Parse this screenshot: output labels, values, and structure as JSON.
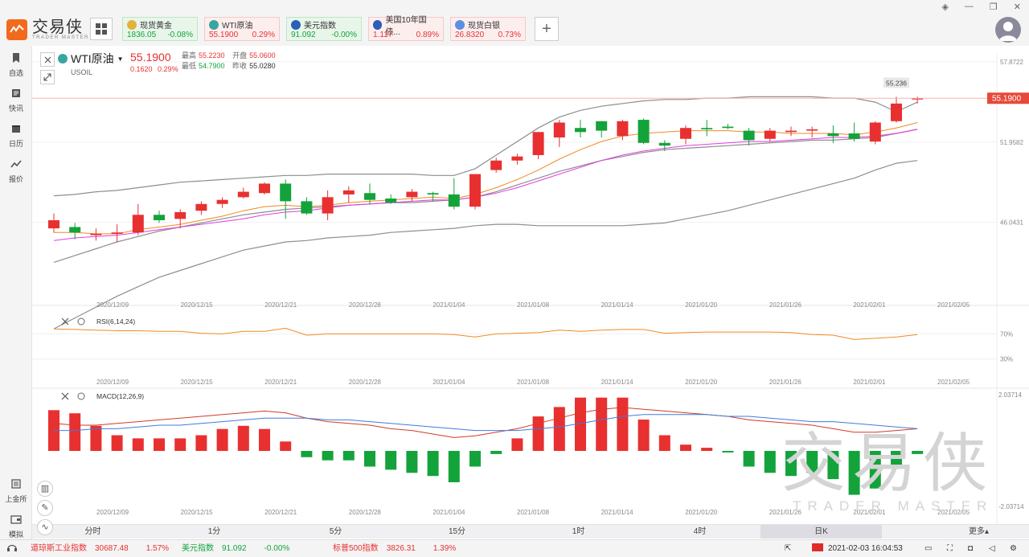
{
  "app": {
    "logo_cn": "交易侠",
    "logo_en": "TRADER MASTER",
    "colors": {
      "up": "#e83030",
      "down": "#13a33a",
      "accent": "#f26a1b",
      "ma_short": "#f08a24",
      "ma_long": "#e23ce2"
    }
  },
  "tickers": [
    {
      "name": "现货黄金",
      "price": "1836.05",
      "change": "-0.08%",
      "dir": "down",
      "icon_color": "#e3b23c"
    },
    {
      "name": "WTI原油",
      "price": "55.1900",
      "change": "0.29%",
      "dir": "up",
      "icon_color": "#3aa5a0"
    },
    {
      "name": "美元指数",
      "price": "91.092",
      "change": "-0.00%",
      "dir": "down",
      "icon_color": "#2b5fb8"
    },
    {
      "name": "美国10年国债...",
      "price": "1.117",
      "change": "0.89%",
      "dir": "up",
      "icon_color": "#2b5fb8"
    },
    {
      "name": "现货白银",
      "price": "26.8320",
      "change": "0.73%",
      "dir": "up",
      "icon_color": "#5b8fe0"
    }
  ],
  "sidebar": [
    {
      "label": "自选",
      "icon": "bookmark-icon"
    },
    {
      "label": "快讯",
      "icon": "news-icon"
    },
    {
      "label": "日历",
      "icon": "calendar-icon"
    },
    {
      "label": "报价",
      "icon": "quote-icon"
    }
  ],
  "sidebar_bottom": [
    {
      "label": "上金所",
      "icon": "exchange-icon"
    },
    {
      "label": "模拟",
      "icon": "wallet-icon"
    }
  ],
  "symbol": {
    "name": "WTI原油",
    "code": "USOIL",
    "price": "55.1900",
    "change": "0.1620",
    "change_pct": "0.29%",
    "high_label": "最高",
    "high": "55.2230",
    "open_label": "开盘",
    "open": "55.0600",
    "low_label": "最低",
    "low": "54.7900",
    "prev_label": "昨收",
    "prev": "55.0280"
  },
  "chart_data": {
    "type": "candlestick",
    "dates_axis": [
      "2020/12/09",
      "2020/12/15",
      "2020/12/21",
      "2020/12/28",
      "2021/01/04",
      "2021/01/08",
      "2021/01/14",
      "2021/01/20",
      "2021/01/26",
      "2021/02/01",
      "2021/02/05"
    ],
    "price_axis": [
      "57.8722",
      "51.9582",
      "46.0431"
    ],
    "ylim": [
      40.1,
      57.87
    ],
    "current_price_label": "55.1900",
    "current_price": 55.19,
    "high_marker_label": "55.236",
    "high_marker": 55.236,
    "candles": [
      [
        45.6,
        46.2,
        45.3,
        46.7
      ],
      [
        45.7,
        45.3,
        44.8,
        46.0
      ],
      [
        45.1,
        45.2,
        44.7,
        45.6
      ],
      [
        45.2,
        45.3,
        44.6,
        45.9
      ],
      [
        45.3,
        46.6,
        45.1,
        47.4
      ],
      [
        46.6,
        46.2,
        46.0,
        46.9
      ],
      [
        46.3,
        46.8,
        45.6,
        47.0
      ],
      [
        46.9,
        47.4,
        46.6,
        47.6
      ],
      [
        47.4,
        47.7,
        47.1,
        47.9
      ],
      [
        47.9,
        48.3,
        47.8,
        48.6
      ],
      [
        48.2,
        48.9,
        48.1,
        49.0
      ],
      [
        48.9,
        47.6,
        46.3,
        49.2
      ],
      [
        47.6,
        46.7,
        46.6,
        47.9
      ],
      [
        46.7,
        47.9,
        46.2,
        48.4
      ],
      [
        48.1,
        48.4,
        47.5,
        48.7
      ],
      [
        48.2,
        47.7,
        47.4,
        48.9
      ],
      [
        47.8,
        47.5,
        47.4,
        48.1
      ],
      [
        47.9,
        48.3,
        47.6,
        48.5
      ],
      [
        48.2,
        48.1,
        47.6,
        48.3
      ],
      [
        48.1,
        47.2,
        47.0,
        49.3
      ],
      [
        47.2,
        49.6,
        47.0,
        49.6
      ],
      [
        49.9,
        50.6,
        49.7,
        50.8
      ],
      [
        50.6,
        50.9,
        50.3,
        51.1
      ],
      [
        51.0,
        52.7,
        50.7,
        52.7
      ],
      [
        52.3,
        53.4,
        51.6,
        53.6
      ],
      [
        53.0,
        52.7,
        52.3,
        53.6
      ],
      [
        53.5,
        52.8,
        52.3,
        53.5
      ],
      [
        52.4,
        53.5,
        52.1,
        53.6
      ],
      [
        53.6,
        51.9,
        51.8,
        53.7
      ],
      [
        51.9,
        51.7,
        51.3,
        52.1
      ],
      [
        52.2,
        53.0,
        51.8,
        53.2
      ],
      [
        53.0,
        52.9,
        52.4,
        53.6
      ],
      [
        53.1,
        53.0,
        52.9,
        53.3
      ],
      [
        52.8,
        52.1,
        51.7,
        53.0
      ],
      [
        52.2,
        52.8,
        52.0,
        53.0
      ],
      [
        52.7,
        52.8,
        52.4,
        53.1
      ],
      [
        52.8,
        52.9,
        52.3,
        53.1
      ],
      [
        52.6,
        52.4,
        51.9,
        53.2
      ],
      [
        52.6,
        52.2,
        52.0,
        53.4
      ],
      [
        52.0,
        53.4,
        51.8,
        53.5
      ],
      [
        53.5,
        54.8,
        53.4,
        55.3
      ],
      [
        55.1,
        55.2,
        54.8,
        55.3
      ]
    ],
    "ma_short": [
      45.3,
      45.3,
      45.2,
      45.2,
      45.5,
      45.7,
      45.9,
      46.2,
      46.5,
      46.9,
      47.2,
      47.3,
      47.2,
      47.3,
      47.5,
      47.6,
      47.7,
      47.8,
      47.9,
      47.8,
      48.1,
      48.6,
      49.2,
      49.9,
      50.7,
      51.4,
      52.0,
      52.4,
      52.6,
      52.7,
      52.8,
      52.8,
      52.8,
      52.7,
      52.7,
      52.6,
      52.6,
      52.6,
      52.5,
      52.7,
      53.0,
      53.4
    ],
    "ma_long": [
      44.7,
      44.9,
      45.0,
      45.1,
      45.3,
      45.5,
      45.7,
      45.9,
      46.1,
      46.3,
      46.6,
      46.8,
      46.9,
      47.1,
      47.3,
      47.4,
      47.5,
      47.6,
      47.7,
      47.7,
      47.9,
      48.2,
      48.6,
      49.1,
      49.6,
      50.1,
      50.6,
      51.0,
      51.3,
      51.5,
      51.7,
      51.8,
      51.9,
      52.0,
      52.0,
      52.1,
      52.2,
      52.3,
      52.3,
      52.4,
      52.6,
      52.9
    ],
    "boll_upper": [
      48.0,
      48.1,
      48.3,
      48.4,
      48.6,
      48.8,
      49.0,
      49.1,
      49.2,
      49.3,
      49.4,
      49.5,
      49.5,
      49.6,
      49.6,
      49.6,
      49.6,
      49.6,
      49.5,
      49.5,
      50.0,
      51.0,
      52.0,
      53.0,
      53.8,
      54.3,
      54.6,
      54.8,
      55.0,
      55.1,
      55.1,
      55.2,
      55.2,
      55.3,
      55.3,
      55.3,
      55.3,
      55.2,
      55.2,
      54.9,
      54.2,
      54.9
    ],
    "boll_middle": [
      43.1,
      43.6,
      44.1,
      44.6,
      45.0,
      45.4,
      45.7,
      46.0,
      46.3,
      46.6,
      46.8,
      47.0,
      47.1,
      47.2,
      47.3,
      47.4,
      47.5,
      47.5,
      47.6,
      47.7,
      47.9,
      48.3,
      48.8,
      49.3,
      49.8,
      50.2,
      50.6,
      50.9,
      51.2,
      51.4,
      51.5,
      51.6,
      51.7,
      51.8,
      51.9,
      52.0,
      52.1,
      52.1,
      52.2,
      52.3,
      52.6,
      52.9
    ],
    "boll_lower": [
      38.2,
      39.0,
      39.8,
      40.6,
      41.3,
      42.0,
      42.5,
      43.0,
      43.5,
      44.0,
      44.3,
      44.6,
      44.7,
      44.9,
      45.0,
      45.1,
      45.3,
      45.4,
      45.5,
      45.6,
      45.8,
      45.9,
      45.9,
      45.8,
      45.8,
      45.8,
      45.8,
      45.8,
      45.9,
      46.0,
      46.3,
      46.6,
      46.9,
      47.3,
      47.7,
      48.1,
      48.5,
      48.9,
      49.3,
      49.9,
      50.4,
      50.6
    ],
    "rsi": {
      "label": "RSI(6,14,24)",
      "axis": [
        "70%",
        "30%"
      ],
      "values": [
        78,
        77,
        76,
        75,
        75,
        74,
        74,
        71,
        70,
        74,
        74,
        79,
        68,
        70,
        70,
        70,
        70,
        70,
        70,
        69,
        65,
        70,
        71,
        72,
        76,
        74,
        76,
        77,
        77,
        71,
        72,
        73,
        73,
        73,
        73,
        72,
        69,
        68,
        61,
        63,
        65,
        69
      ]
    },
    "macd": {
      "label": "MACD(12,26,9)",
      "axis": [
        "2.03714",
        "-2.03714"
      ],
      "hist": [
        1.3,
        1.2,
        0.8,
        0.5,
        0.4,
        0.4,
        0.4,
        0.5,
        0.7,
        0.8,
        0.7,
        0.3,
        -0.2,
        -0.3,
        -0.3,
        -0.5,
        -0.6,
        -0.7,
        -0.8,
        -1.0,
        -0.5,
        -0.1,
        0.4,
        1.1,
        1.4,
        1.7,
        1.7,
        1.7,
        1.0,
        0.5,
        0.2,
        0.1,
        -0.05,
        -0.5,
        -0.7,
        -0.8,
        -0.7,
        -0.9,
        -1.4,
        -1.2,
        -0.5,
        -0.1
      ],
      "dif": [
        1.3,
        1.2,
        1.2,
        1.3,
        1.4,
        1.5,
        1.6,
        1.7,
        1.8,
        1.9,
        2.0,
        1.9,
        1.6,
        1.4,
        1.3,
        1.2,
        1.0,
        0.9,
        0.7,
        0.5,
        0.6,
        0.8,
        1.0,
        1.3,
        1.6,
        1.9,
        2.1,
        2.2,
        2.1,
        2.0,
        1.9,
        1.8,
        1.7,
        1.5,
        1.4,
        1.3,
        1.2,
        1.0,
        0.8,
        0.8,
        0.9,
        1.0
      ],
      "dea": [
        0.9,
        0.9,
        1.0,
        1.0,
        1.1,
        1.2,
        1.2,
        1.3,
        1.4,
        1.5,
        1.6,
        1.6,
        1.6,
        1.5,
        1.5,
        1.4,
        1.3,
        1.2,
        1.1,
        1.0,
        0.9,
        0.9,
        0.9,
        1.0,
        1.1,
        1.3,
        1.5,
        1.7,
        1.8,
        1.8,
        1.8,
        1.8,
        1.7,
        1.7,
        1.6,
        1.5,
        1.4,
        1.4,
        1.3,
        1.2,
        1.1,
        1.0
      ]
    }
  },
  "timeframes": [
    "分时",
    "1分",
    "5分",
    "15分",
    "1时",
    "4时",
    "日K"
  ],
  "timeframe_active": "日K",
  "timeframe_more": "更多▴",
  "status": {
    "items": [
      {
        "name": "道琼斯工业指数",
        "value": "30687.48",
        "change": "1.57%"
      },
      {
        "name": "美元指数",
        "value": "91.092",
        "change": "-0.00%"
      },
      {
        "name": "标普500指数",
        "value": "3826.31",
        "change": "1.39%"
      }
    ],
    "datetime": "2021-02-03 16:04:53"
  },
  "watermark": {
    "cn": "交易侠",
    "en": "TRADER MASTER"
  }
}
